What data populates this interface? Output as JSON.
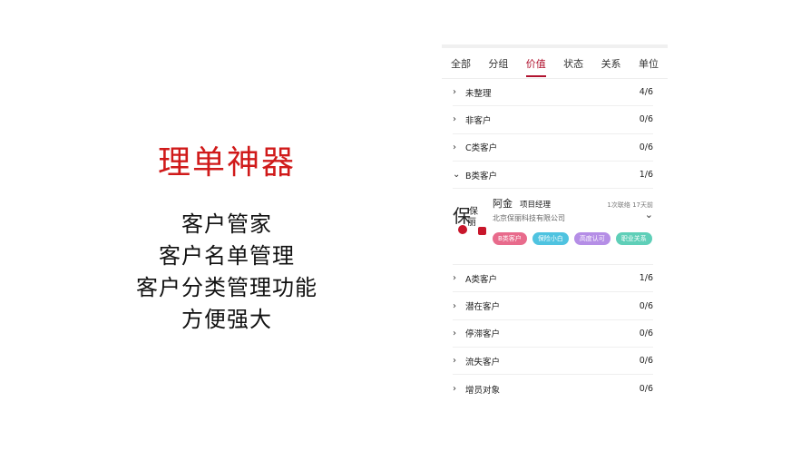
{
  "promo": {
    "title": "理单神器",
    "lines": [
      "客户管家",
      "客户名单管理",
      "客户分类管理功能",
      "方便强大"
    ]
  },
  "tabs": [
    {
      "label": "全部",
      "active": false
    },
    {
      "label": "分组",
      "active": false
    },
    {
      "label": "价值",
      "active": true
    },
    {
      "label": "状态",
      "active": false
    },
    {
      "label": "关系",
      "active": false
    },
    {
      "label": "单位",
      "active": false
    }
  ],
  "groups_top": [
    {
      "label": "未整理",
      "count": "4/6",
      "icon": "chevron-right-icon",
      "glyph": "›"
    },
    {
      "label": "非客户",
      "count": "0/6",
      "icon": "chevron-right-icon",
      "glyph": "›"
    },
    {
      "label": "C类客户",
      "count": "0/6",
      "icon": "chevron-right-icon",
      "glyph": "›"
    },
    {
      "label": "B类客户",
      "count": "1/6",
      "icon": "chevron-down-icon",
      "glyph": "⌄"
    }
  ],
  "contact": {
    "name": "阿金",
    "role": "项目经理",
    "meta": "1次联络  17天前",
    "company": "北京保丽科技有限公司",
    "tags": [
      {
        "label": "B类客户",
        "color": "#e86b8c"
      },
      {
        "label": "保险小白",
        "color": "#4fc3e0"
      },
      {
        "label": "高度认可",
        "color": "#b58ee6"
      },
      {
        "label": "职业关系",
        "color": "#5fcfb8"
      }
    ]
  },
  "groups_bottom": [
    {
      "label": "A类客户",
      "count": "1/6"
    },
    {
      "label": "潜在客户",
      "count": "0/6"
    },
    {
      "label": "停滞客户",
      "count": "0/6"
    },
    {
      "label": "流失客户",
      "count": "0/6"
    },
    {
      "label": "增员对象",
      "count": "0/6"
    }
  ],
  "colors": {
    "accent": "#b0122e",
    "promo_title": "#d01a1a"
  }
}
